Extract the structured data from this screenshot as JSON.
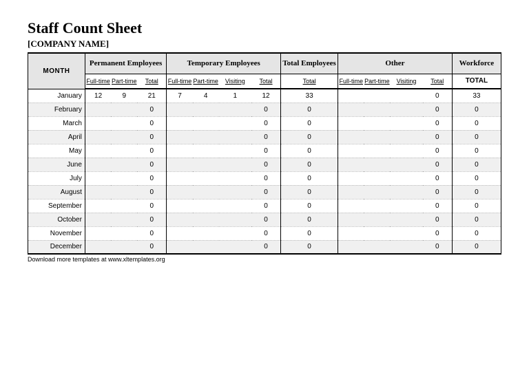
{
  "title": "Staff Count Sheet",
  "company": "[COMPANY NAME]",
  "headers": {
    "month": "MONTH",
    "permanent": "Permanent Employees",
    "temporary": "Temporary Employees",
    "totalEmp": "Total Employees",
    "other": "Other",
    "workforce": "Workforce",
    "full": "Full-time",
    "part": "Part-time",
    "visiting": "Visiting",
    "total": "Total",
    "TOTAL": "TOTAL"
  },
  "rows": [
    {
      "month": "January",
      "pFull": "12",
      "pPart": "9",
      "pTot": "21",
      "tFull": "7",
      "tPart": "4",
      "tVis": "1",
      "tTot": "12",
      "eTot": "33",
      "oFull": "",
      "oPart": "",
      "oVis": "",
      "oTot": "0",
      "wTot": "33"
    },
    {
      "month": "February",
      "pFull": "",
      "pPart": "",
      "pTot": "0",
      "tFull": "",
      "tPart": "",
      "tVis": "",
      "tTot": "0",
      "eTot": "0",
      "oFull": "",
      "oPart": "",
      "oVis": "",
      "oTot": "0",
      "wTot": "0"
    },
    {
      "month": "March",
      "pFull": "",
      "pPart": "",
      "pTot": "0",
      "tFull": "",
      "tPart": "",
      "tVis": "",
      "tTot": "0",
      "eTot": "0",
      "oFull": "",
      "oPart": "",
      "oVis": "",
      "oTot": "0",
      "wTot": "0"
    },
    {
      "month": "April",
      "pFull": "",
      "pPart": "",
      "pTot": "0",
      "tFull": "",
      "tPart": "",
      "tVis": "",
      "tTot": "0",
      "eTot": "0",
      "oFull": "",
      "oPart": "",
      "oVis": "",
      "oTot": "0",
      "wTot": "0"
    },
    {
      "month": "May",
      "pFull": "",
      "pPart": "",
      "pTot": "0",
      "tFull": "",
      "tPart": "",
      "tVis": "",
      "tTot": "0",
      "eTot": "0",
      "oFull": "",
      "oPart": "",
      "oVis": "",
      "oTot": "0",
      "wTot": "0"
    },
    {
      "month": "June",
      "pFull": "",
      "pPart": "",
      "pTot": "0",
      "tFull": "",
      "tPart": "",
      "tVis": "",
      "tTot": "0",
      "eTot": "0",
      "oFull": "",
      "oPart": "",
      "oVis": "",
      "oTot": "0",
      "wTot": "0"
    },
    {
      "month": "July",
      "pFull": "",
      "pPart": "",
      "pTot": "0",
      "tFull": "",
      "tPart": "",
      "tVis": "",
      "tTot": "0",
      "eTot": "0",
      "oFull": "",
      "oPart": "",
      "oVis": "",
      "oTot": "0",
      "wTot": "0"
    },
    {
      "month": "August",
      "pFull": "",
      "pPart": "",
      "pTot": "0",
      "tFull": "",
      "tPart": "",
      "tVis": "",
      "tTot": "0",
      "eTot": "0",
      "oFull": "",
      "oPart": "",
      "oVis": "",
      "oTot": "0",
      "wTot": "0"
    },
    {
      "month": "September",
      "pFull": "",
      "pPart": "",
      "pTot": "0",
      "tFull": "",
      "tPart": "",
      "tVis": "",
      "tTot": "0",
      "eTot": "0",
      "oFull": "",
      "oPart": "",
      "oVis": "",
      "oTot": "0",
      "wTot": "0"
    },
    {
      "month": "October",
      "pFull": "",
      "pPart": "",
      "pTot": "0",
      "tFull": "",
      "tPart": "",
      "tVis": "",
      "tTot": "0",
      "eTot": "0",
      "oFull": "",
      "oPart": "",
      "oVis": "",
      "oTot": "0",
      "wTot": "0"
    },
    {
      "month": "November",
      "pFull": "",
      "pPart": "",
      "pTot": "0",
      "tFull": "",
      "tPart": "",
      "tVis": "",
      "tTot": "0",
      "eTot": "0",
      "oFull": "",
      "oPart": "",
      "oVis": "",
      "oTot": "0",
      "wTot": "0"
    },
    {
      "month": "December",
      "pFull": "",
      "pPart": "",
      "pTot": "0",
      "tFull": "",
      "tPart": "",
      "tVis": "",
      "tTot": "0",
      "eTot": "0",
      "oFull": "",
      "oPart": "",
      "oVis": "",
      "oTot": "0",
      "wTot": "0"
    }
  ],
  "footnote": "Download more templates at www.xltemplates.org"
}
